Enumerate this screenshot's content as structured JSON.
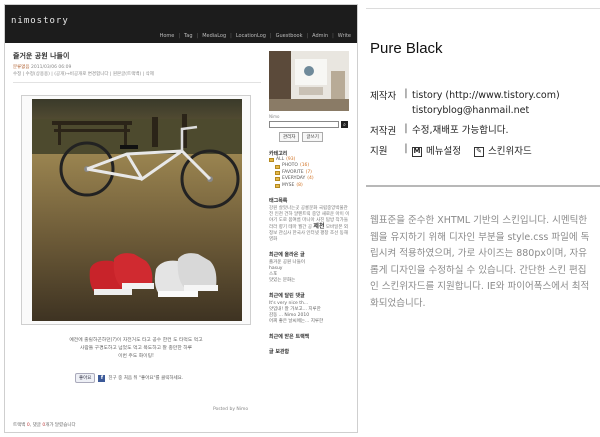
{
  "preview": {
    "blog_name": "nimostory",
    "nav": [
      "Home",
      "Tag",
      "MediaLog",
      "LocationLog",
      "Guestbook",
      "Admin",
      "Write"
    ],
    "post_title": "즐거운 공원 나들이",
    "post_category_label": "분류없음",
    "post_date": "2011/03/06 06:09",
    "post_meta_line": "수정 | 수정(상용용) | (공개)→비공개로 변경합니다 | 원본글(트랙백) | 삭제",
    "caption_line1": "예전에 출릴하곤하던(?)이 자전거도 타고 공수 한컨 도 타먹도 먹고",
    "caption_line2": "사람들 구경도하고 넘었도 먹고 목도하고 잘 충만한 하루",
    "caption_line3": "이번 주도 화이팅!",
    "like_button": "좋아요",
    "like_text": "친구 중 처음 뒤 \"좋아요\"를 클릭하세요.",
    "posted_by": "Posted by Nimo",
    "trackback_label": "트랙백",
    "trackback_count": "0",
    "comment_label": "댓글",
    "comment_count": "0",
    "comment_suffix": "개가 달렸습니다",
    "sidebar": {
      "small_label": "Nimo",
      "btn_admin": "관리자",
      "btn_write": "글쓰기",
      "category_title": "카테고리",
      "categories": [
        {
          "name": "ALL",
          "count": "(93)"
        },
        {
          "name": "PHOTO",
          "count": "(16)"
        },
        {
          "name": "FAVORITE",
          "count": "(7)"
        },
        {
          "name": "EVERYDAY",
          "count": "(4)"
        },
        {
          "name": "MYSE",
          "count": "(8)"
        }
      ],
      "tag_title": "태그목록",
      "tags_1": "강원 살맛나는곳 공룡문화 국립중앙박물관 전 인천 건하 알펜트릭 중앙 새로운 아이 이야기 도로 봄여름 마니아 사진 탐방 작가들 라라 향기 테마 월간 공",
      "tags_big": "제천",
      "tags_2": "모바일폰 외 정보 관심사 한국사 인터넷 평창 조선 동해 영화",
      "recent_posts_title": "최근에 올라온 글",
      "recent_posts": [
        "즐거운 공원 나들이",
        "hasuy",
        "스포",
        "맛있는 문화는"
      ],
      "recent_comments_title": "최근에 달린 댓글",
      "recent_comments": [
        "It's very nice th...",
        "앗입내! 잘 가보고... 지루한",
        "감동 ... Nimo 2010",
        "어찌 좋은 날씨에는... 지루한"
      ],
      "recent_trackbacks_title": "최근에 받은 트랙백",
      "archive_title": "글 보관함"
    }
  },
  "info": {
    "theme_name": "Pure Black",
    "author_label": "제작자",
    "author_line1": "tistory (http://www.tistory.com)",
    "author_line2": "tistoryblog@hanmail.net",
    "copyright_label": "저작권",
    "copyright_value": "수정,재배포 가능합니다.",
    "support_label": "지원",
    "support_menu": "메뉴설정",
    "support_wizard": "스킨위자드",
    "separator": "|",
    "description": "웹표준을 준수한 XHTML 기반의 스킨입니다. 시멘틱한 웹을 유지하기 위해 디자인 부분을 style.css 파일에 독립시켜 적용하였으며, 가로 사이즈는 880px이며, 자유롭게 디자인을 수정하실 수 있습니다. 간단한 스킨 편집인 스킨위자드를 지원합니다. IE와 파이어폭스에서 최적화되었습니다."
  },
  "colors": {
    "header_bg": "#1c1c1c",
    "accent_orange": "#d07020"
  }
}
